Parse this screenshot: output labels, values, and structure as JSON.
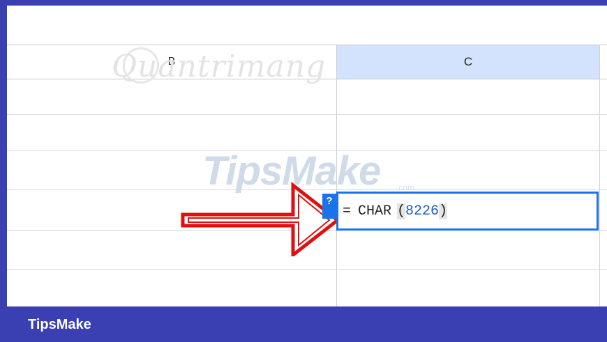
{
  "colors": {
    "frame": "#3a3fb2",
    "selected_header": "#d3e3fd",
    "active_border": "#1a73e8",
    "arrow": "#e01010"
  },
  "columns": {
    "b": "B",
    "c": "C"
  },
  "formula": {
    "equals": "=",
    "function": "CHAR",
    "open": "(",
    "number": "8226",
    "close": ")"
  },
  "help_icon": "?",
  "footer": {
    "brand": "TipsMake"
  },
  "watermarks": {
    "primary": "TipsMake",
    "secondary": "Quantrimang",
    "domain": ".com"
  },
  "icons": {
    "arrow": "red-outline-arrow-right",
    "help": "question-mark-icon"
  }
}
